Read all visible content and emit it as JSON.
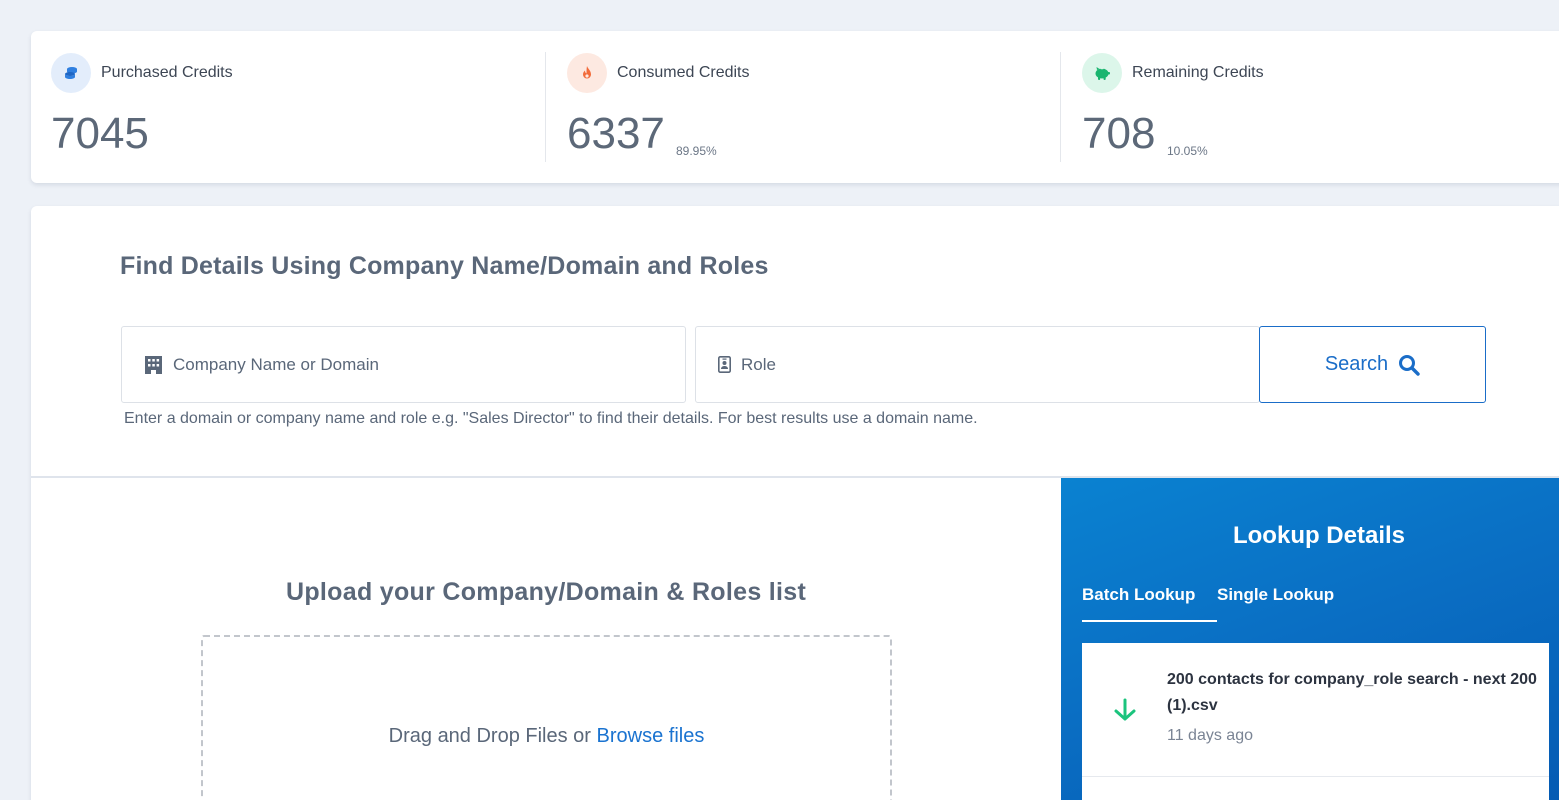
{
  "stats": {
    "purchased": {
      "label": "Purchased Credits",
      "value": "7045"
    },
    "consumed": {
      "label": "Consumed Credits",
      "value": "6337",
      "percent": "89.95%"
    },
    "remaining": {
      "label": "Remaining Credits",
      "value": "708",
      "percent": "10.05%"
    }
  },
  "find": {
    "title": "Find Details Using Company Name/Domain and Roles",
    "company_placeholder": "Company Name or Domain",
    "role_placeholder": "Role",
    "search_label": "Search",
    "hint": "Enter a domain or company name and role e.g. \"Sales Director\" to find their details. For best results use a domain name."
  },
  "upload": {
    "title": "Upload your Company/Domain & Roles list",
    "drag_text": "Drag and Drop Files or ",
    "browse_label": "Browse files"
  },
  "lookup": {
    "title": "Lookup Details",
    "tabs": [
      {
        "label": "Batch Lookup",
        "active": true
      },
      {
        "label": "Single Lookup",
        "active": false
      }
    ],
    "items": [
      {
        "filename": "200 contacts for company_role search - next 200 (1).csv",
        "time": "11 days ago",
        "icon": "download-arrow-icon"
      }
    ]
  },
  "colors": {
    "accent": "#1a6dc8",
    "download_green": "#1bc47d",
    "panel_blue": "#0a6ec3"
  }
}
